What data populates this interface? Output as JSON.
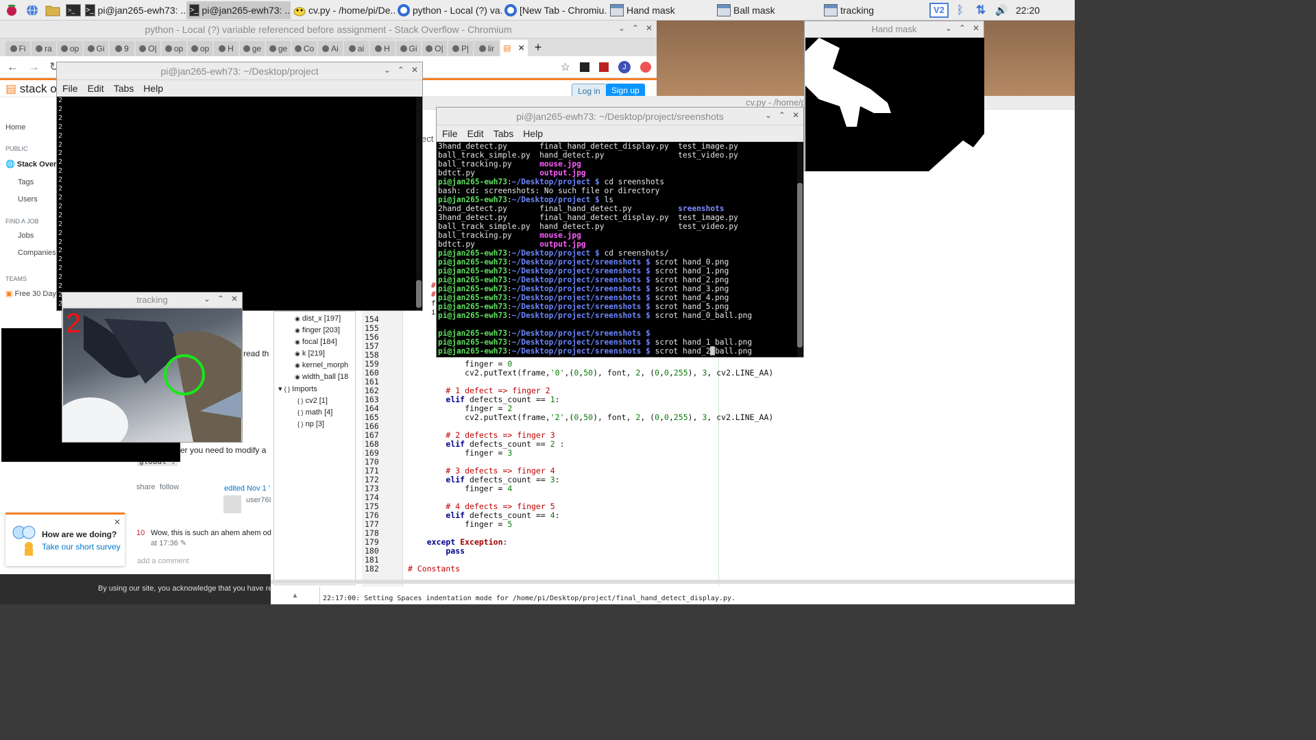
{
  "taskbar": {
    "tasks": [
      {
        "label": "pi@jan265-ewh73: ..."
      },
      {
        "label": "pi@jan265-ewh73: ..."
      },
      {
        "label": "cv.py - /home/pi/De..."
      },
      {
        "label": "python - Local (?) va..."
      },
      {
        "label": "[New Tab - Chromiu..."
      },
      {
        "label": "Hand mask"
      },
      {
        "label": "Ball mask"
      },
      {
        "label": "tracking"
      }
    ],
    "clock": "22:20"
  },
  "chromium": {
    "title": "python - Local (?) variable referenced before assignment - Stack Overflow - Chromium",
    "tabs": [
      "Fi",
      "ra",
      "op",
      "Gi",
      "9",
      "O|",
      "op",
      "op",
      "H",
      "ge",
      "ge",
      "Co",
      "Ai",
      "ai",
      "H",
      "Gi",
      "O|",
      "P|",
      "lir"
    ],
    "login": "Log in",
    "signup": "Sign up"
  },
  "stackoverflow": {
    "logo": "stack ov",
    "home": "Home",
    "public": "PUBLIC",
    "stack_overflow": "Stack Over",
    "tags": "Tags",
    "users": "Users",
    "find_job": "FIND A JOB",
    "jobs": "Jobs",
    "companies": "Companies",
    "teams": "TEAMS",
    "free_trial": "Free 30 Day",
    "read_th": "read th",
    "modify": "er you need to modify a",
    "global": "global .",
    "share": "share",
    "follow": "follow",
    "edited": "edited Nov 1 '17",
    "user": "user768",
    "comment_score": "10",
    "comment_text": "Wow, this is such an ahem ahem odd",
    "comment_time": "at 17:36",
    "add_comment": "add a comment",
    "survey_title": "How are we doing?",
    "survey_link": "Take our short survey",
    "cookie": "By using our site, you acknowledge that you have rea"
  },
  "terminal1": {
    "title": "pi@jan265-ewh73: ~/Desktop/project",
    "menu": [
      "File",
      "Edit",
      "Tabs",
      "Help"
    ],
    "output": "2\n2\n2\n2\n2\n2\n2\n2\n2\n2\n2\n2\n2\n2\n2\n2\n2\n2\n2\n2\n2\n2\n2\n2"
  },
  "tracking": {
    "title": "tracking",
    "finger_count": "2"
  },
  "hand_mask": {
    "title": "Hand mask"
  },
  "geany": {
    "title_fragment": "cv.py - /home/pi/De",
    "tab_fragment": "ect",
    "status": "22:17:00: Setting Spaces indentation mode for /home/pi/Desktop/project/final_hand_detect_display.py.",
    "symbols": [
      {
        "label": "dist_x [197]"
      },
      {
        "label": "finger [203]"
      },
      {
        "label": "focal [184]"
      },
      {
        "label": "k [219]"
      },
      {
        "label": "kernel_morph"
      },
      {
        "label": "width_ball [18"
      }
    ],
    "imports_label": "Imports",
    "imports": [
      {
        "label": "cv2 [1]"
      },
      {
        "label": "math [4]"
      },
      {
        "label": "np [3]"
      }
    ],
    "line_numbers": [
      "154",
      "155",
      "156",
      "157",
      "158",
      "159",
      "160",
      "161",
      "162",
      "163",
      "164",
      "165",
      "166",
      "167",
      "168",
      "169",
      "170",
      "171",
      "172",
      "173",
      "174",
      "175",
      "176",
      "177",
      "178",
      "179",
      "180",
      "181",
      "182"
    ],
    "code_lines": [
      "",
      "",
      "",
      "",
      "",
      "            finger = 0",
      "            cv2.putText(frame,'0',(0,50), font, 2, (0,0,255), 3, cv2.LINE_AA)",
      "",
      "        # 1 defect => finger 2",
      "        elif defects_count == 1:",
      "            finger = 2",
      "            cv2.putText(frame,'2',(0,50), font, 2, (0,0,255), 3, cv2.LINE_AA)",
      "",
      "        # 2 defects => finger 3",
      "        elif defects_count == 2 :",
      "            finger = 3",
      "",
      "        # 3 defects => finger 4",
      "        elif defects_count == 3:",
      "            finger = 4",
      "",
      "        # 4 defects => finger 5",
      "        elif defects_count == 4:",
      "            finger = 5",
      "",
      "    except Exception:",
      "        pass",
      "",
      "# Constants"
    ]
  },
  "terminal2": {
    "title": "pi@jan265-ewh73: ~/Desktop/project/sreenshots",
    "menu": [
      "File",
      "Edit",
      "Tabs",
      "Help"
    ]
  }
}
